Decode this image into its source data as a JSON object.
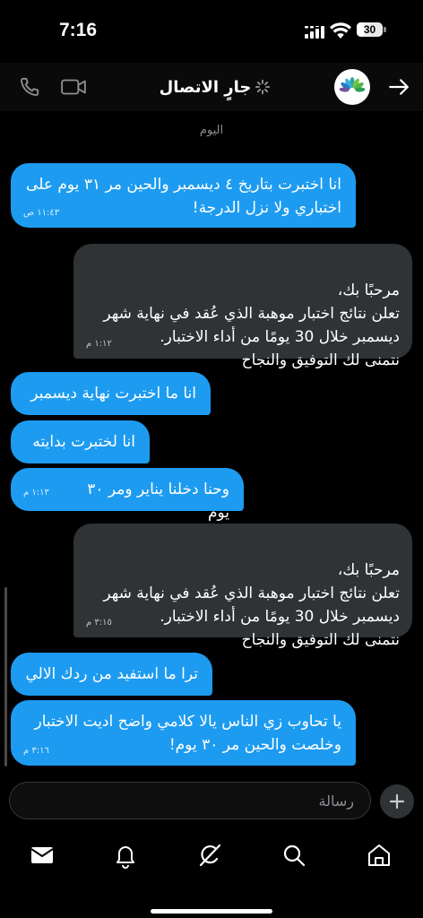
{
  "status_bar": {
    "time": "7:16",
    "battery": "30",
    "battery_level": 0.3
  },
  "header": {
    "title": "جارٍ الاتصال"
  },
  "conversation": {
    "day_label": "اليوم",
    "messages": [
      {
        "from": "me",
        "text": "انا اختبرت بتاريخ ٤ ديسمبر والحين مر ٣١ يوم على اختباري ولا نزل الدرجة!",
        "time": "١١:٤٣ ص"
      },
      {
        "from": "them",
        "text": "مرحبًا بك،\nتعلن نتائج اختبار موهبة الذي عُقد في نهاية شهر ديسمبر خلال 30 يومًا من أداء الاختبار.\nنتمنى لك التوفيق والنجاح",
        "time": "١:١٢ م"
      },
      {
        "from": "me",
        "text": "انا ما اختبرت نهاية ديسمبر",
        "time": ""
      },
      {
        "from": "me",
        "text": "انا لختبرت بدايته",
        "time": ""
      },
      {
        "from": "me",
        "text": "وحنا دخلنا يناير ومر ٣٠ يوم",
        "time": "١:١٣ م"
      },
      {
        "from": "them",
        "text": "مرحبًا بك،\nتعلن نتائج اختبار موهبة الذي عُقد في نهاية شهر ديسمبر خلال 30 يومًا من أداء الاختبار.\nنتمنى لك التوفيق والنجاح",
        "time": "٣:١٥ م"
      },
      {
        "from": "me",
        "text": "ترا ما استفيد من ردك الالي",
        "time": ""
      },
      {
        "from": "me",
        "text": "يا تحاوب زي الناس يالا كلامي واضح اديت الاختبار وخلصت والحين مر ٣٠ يوم!",
        "time": "٣:١٦ م"
      }
    ]
  },
  "composer": {
    "placeholder": "رسالة"
  },
  "colors": {
    "sent_bubble": "#1d9bf0",
    "received_bubble": "#2f3336",
    "background": "#000000"
  },
  "icons": [
    "phone-icon",
    "video-icon",
    "spinner-icon",
    "back-arrow-icon",
    "plus-icon",
    "mail-icon",
    "bell-icon",
    "grok-icon",
    "search-icon",
    "home-icon"
  ]
}
